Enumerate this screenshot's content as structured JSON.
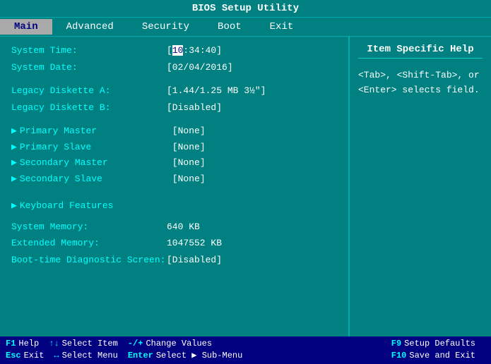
{
  "title": "BIOS Setup Utility",
  "menu": {
    "items": [
      {
        "label": "Main",
        "active": true
      },
      {
        "label": "Advanced",
        "active": false
      },
      {
        "label": "Security",
        "active": false
      },
      {
        "label": "Boot",
        "active": false
      },
      {
        "label": "Exit",
        "active": false
      }
    ]
  },
  "help_panel": {
    "title": "Item Specific Help",
    "text": "<Tab>, <Shift-Tab>, or <Enter> selects field."
  },
  "fields": {
    "system_time_label": "System Time:",
    "system_time_value_prefix": "[",
    "system_time_cursor": "10",
    "system_time_value_suffix": ":34:40]",
    "system_date_label": "System Date:",
    "system_date_value": "[02/04/2016]",
    "legacy_a_label": "Legacy Diskette A:",
    "legacy_a_value": "[1.44/1.25 MB  3½\"]",
    "legacy_b_label": "Legacy Diskette B:",
    "legacy_b_value": "[Disabled]",
    "primary_master_label": "Primary Master",
    "primary_master_value": "[None]",
    "primary_slave_label": "Primary Slave",
    "primary_slave_value": "[None]",
    "secondary_master_label": "Secondary Master",
    "secondary_master_value": "[None]",
    "secondary_slave_label": "Secondary Slave",
    "secondary_slave_value": "[None]",
    "keyboard_features_label": "Keyboard Features",
    "system_memory_label": "System Memory:",
    "system_memory_value": "640 KB",
    "extended_memory_label": "Extended Memory:",
    "extended_memory_value": "1047552 KB",
    "boot_diagnostic_label": "Boot-time Diagnostic Screen:",
    "boot_diagnostic_value": "[Disabled]"
  },
  "status_bar": {
    "row1": [
      {
        "key": "F1",
        "desc": "Help"
      },
      {
        "key": "↑↓",
        "desc": "Select Item"
      },
      {
        "key": "-/+",
        "desc": "Change Values"
      },
      {
        "key": "F9",
        "desc": "Setup Defaults"
      }
    ],
    "row2": [
      {
        "key": "Esc",
        "desc": "Exit"
      },
      {
        "key": "↔",
        "desc": "Select Menu"
      },
      {
        "key": "Enter",
        "desc": "Select ▶ Sub-Menu"
      },
      {
        "key": "F10",
        "desc": "Save and Exit"
      }
    ]
  }
}
